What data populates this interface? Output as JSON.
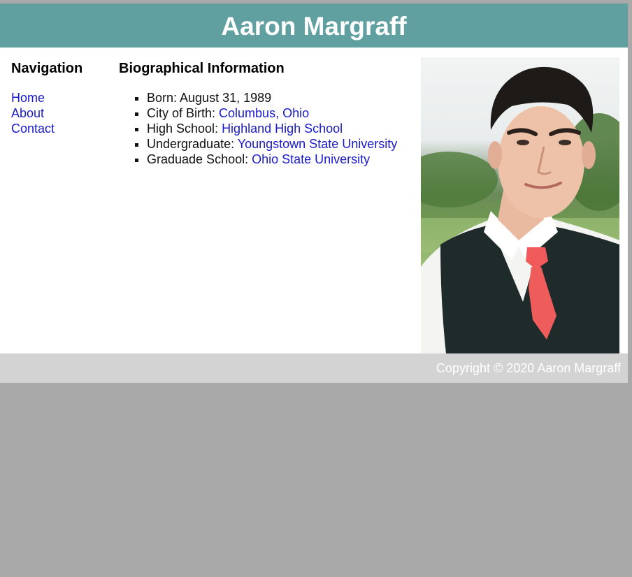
{
  "header": {
    "title": "Aaron Margraff"
  },
  "nav": {
    "heading": "Navigation",
    "links": [
      "Home",
      "About",
      "Contact"
    ]
  },
  "bio": {
    "heading": "Biographical Information",
    "items": [
      {
        "label": "Born: ",
        "value": "August 31, 1989"
      },
      {
        "label": "City of Birth: ",
        "link": "Columbus, Ohio"
      },
      {
        "label": "High School: ",
        "link": "Highland High School"
      },
      {
        "label": "Undergraduate: ",
        "link": "Youngstown State University"
      },
      {
        "label": "Graduade School: ",
        "link": "Ohio State University"
      }
    ]
  },
  "footer": {
    "copyright": "Copyright © 2020 Aaron Margraff"
  },
  "colors": {
    "header_bg": "#60a0a0",
    "footer_bg": "#d3d3d3",
    "page_bg": "#a9a9a9",
    "link": "#1a1acd"
  }
}
